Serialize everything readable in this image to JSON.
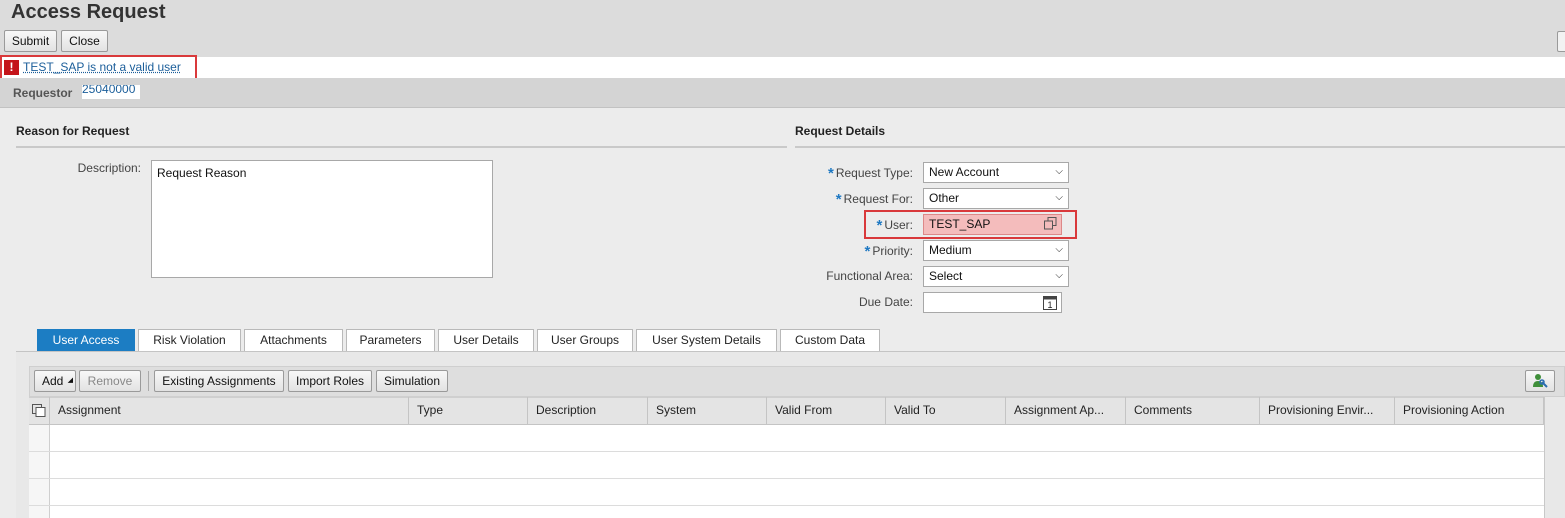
{
  "header": {
    "title": "Access Request",
    "submit_label": "Submit",
    "close_label": "Close"
  },
  "message": {
    "text": "TEST_SAP is not a valid user",
    "icon": "!"
  },
  "requestor": {
    "label": "Requestor",
    "value": "25040000"
  },
  "reason": {
    "title": "Reason for Request",
    "description_label": "Description:",
    "description_value": "Request Reason"
  },
  "details": {
    "title": "Request Details",
    "request_type_label": "Request Type:",
    "request_type_value": "New Account",
    "request_for_label": "Request For:",
    "request_for_value": "Other",
    "user_label": "User:",
    "user_value": "TEST_SAP",
    "priority_label": "Priority:",
    "priority_value": "Medium",
    "functional_area_label": "Functional Area:",
    "functional_area_value": "Select",
    "due_date_label": "Due Date:",
    "due_date_value": "",
    "calendar_day": "1"
  },
  "tabs": [
    {
      "label": "User Access"
    },
    {
      "label": "Risk Violation"
    },
    {
      "label": "Attachments"
    },
    {
      "label": "Parameters"
    },
    {
      "label": "User Details"
    },
    {
      "label": "User Groups"
    },
    {
      "label": "User System Details"
    },
    {
      "label": "Custom Data"
    }
  ],
  "toolbar": {
    "add_label": "Add",
    "remove_label": "Remove",
    "existing_label": "Existing Assignments",
    "import_label": "Import Roles",
    "simulation_label": "Simulation"
  },
  "table": {
    "columns": [
      "Assignment",
      "Type",
      "Description",
      "System",
      "Valid From",
      "Valid To",
      "Assignment Ap...",
      "Comments",
      "Provisioning Envir...",
      "Provisioning Action"
    ]
  },
  "colors": {
    "accent": "#1c7dc3",
    "error": "#c4141a",
    "highlight": "#d9393b",
    "error_field": "#f4bcbc"
  }
}
